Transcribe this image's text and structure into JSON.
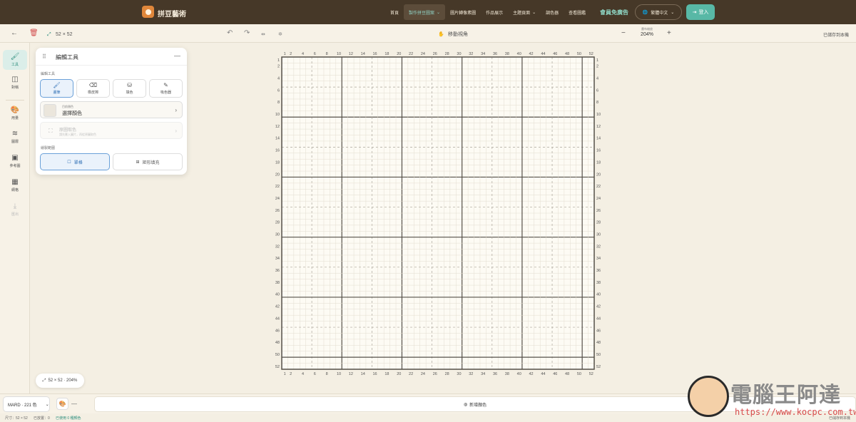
{
  "nav": {
    "brand": "拼豆藝術",
    "links": [
      {
        "label": "首頁",
        "active": false,
        "dropdown": false
      },
      {
        "label": "製作拼豆圖案",
        "active": true,
        "dropdown": true
      },
      {
        "label": "圖片轉像素圖",
        "active": false,
        "dropdown": false
      },
      {
        "label": "作品展示",
        "active": false,
        "dropdown": false
      },
      {
        "label": "主題頁面",
        "active": false,
        "dropdown": true
      },
      {
        "label": "調色器",
        "active": false,
        "dropdown": false
      },
      {
        "label": "查看圖鑑",
        "active": false,
        "dropdown": false
      }
    ],
    "vip": "會員免廣告",
    "language": "繁體中文",
    "login": "登入"
  },
  "toolbar": {
    "size": "52 × 52",
    "move_view": "移動視角",
    "zoom_label": "畫布縮放",
    "zoom_value": "204%",
    "saved": "已儲存到本機"
  },
  "sidebar": [
    {
      "label": "工具",
      "icon": "brush-icon",
      "active": true
    },
    {
      "label": "對稱",
      "icon": "symmetry-icon",
      "active": false
    },
    {
      "label": "用量",
      "icon": "palette-icon",
      "active": false
    },
    {
      "label": "圖層",
      "icon": "layers-icon",
      "active": false
    },
    {
      "label": "參考圖",
      "icon": "image-icon",
      "active": false
    },
    {
      "label": "網格",
      "icon": "grid-icon",
      "active": false
    },
    {
      "label": "匯出",
      "icon": "download-icon",
      "active": false,
      "disabled": true
    }
  ],
  "panel": {
    "title": "編輯工具",
    "section_tools": "編輯工具",
    "tools": [
      {
        "label": "畫筆",
        "active": true
      },
      {
        "label": "橡皮擦",
        "active": false
      },
      {
        "label": "填色",
        "active": false
      },
      {
        "label": "吸色器",
        "active": false
      }
    ],
    "selected_color_key": "目前顏色",
    "selected_color_value": "選擇顏色",
    "pick_title": "原圖取色",
    "pick_hint": "請先匯入圖片，再從原圖取色",
    "section_mode": "繪製範圍",
    "modes": [
      {
        "label": "單格",
        "active": true
      },
      {
        "label": "矩形填充",
        "active": false
      }
    ]
  },
  "size_pill": "52 × 52 · 204%",
  "bottom": {
    "palette": "MARD · 221 色",
    "dash": "—",
    "add_color": "新增顏色"
  },
  "status": {
    "size": "尺寸：52 × 52",
    "placed": "已放置：0",
    "used": "已使用 0 種顏色",
    "saved": "已儲存到本機"
  },
  "watermark": {
    "title": "電腦王阿達",
    "url": "https://www.kocpc.com.tw/"
  },
  "canvas": {
    "columns": 52,
    "rows": 52,
    "axis_labels_top": [
      "1",
      "2",
      "4",
      "6",
      "8",
      "10",
      "12",
      "14",
      "16",
      "18",
      "20",
      "22",
      "24",
      "26",
      "28",
      "30",
      "32",
      "34",
      "36",
      "38",
      "40",
      "42",
      "44",
      "46",
      "48",
      "50",
      "52"
    ],
    "axis_labels_left": [
      "1",
      "2",
      "4",
      "6",
      "8",
      "10",
      "12",
      "14",
      "16",
      "18",
      "20",
      "22",
      "24",
      "26",
      "28",
      "30",
      "32",
      "34",
      "36",
      "38",
      "40",
      "42",
      "44",
      "46",
      "48",
      "50",
      "52"
    ],
    "label_step": 2,
    "major_every": 10,
    "mid_every": 5,
    "colors": {
      "cell": "#fdfbf4",
      "minor": "#e3ddd0",
      "mid": "#a9a398",
      "major": "#555049",
      "label": "#555"
    }
  }
}
